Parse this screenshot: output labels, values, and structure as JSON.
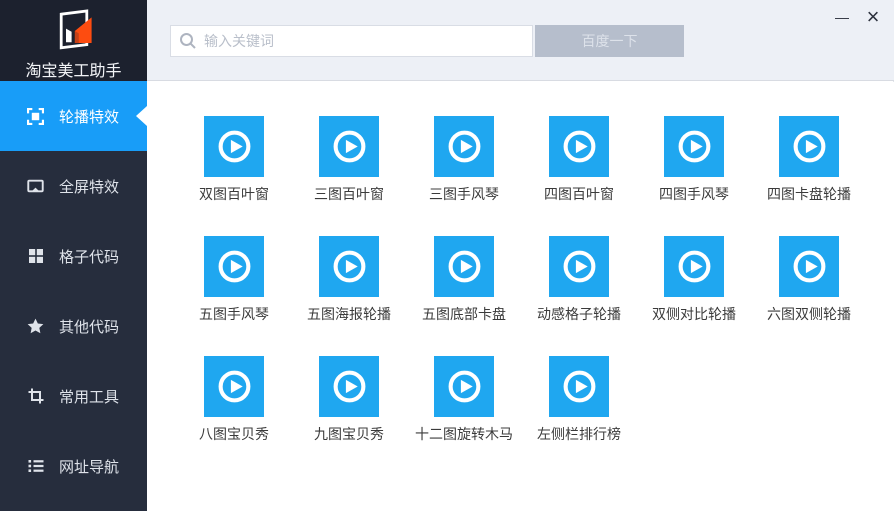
{
  "app": {
    "title": "淘宝美工助手"
  },
  "window_controls": {
    "minimize": "—",
    "close": "×"
  },
  "sidebar": {
    "items": [
      {
        "label": "轮播特效",
        "icon": "carousel-icon",
        "active": true
      },
      {
        "label": "全屏特效",
        "icon": "fullscreen-icon",
        "active": false
      },
      {
        "label": "格子代码",
        "icon": "grid-icon",
        "active": false
      },
      {
        "label": "其他代码",
        "icon": "star-icon",
        "active": false
      },
      {
        "label": "常用工具",
        "icon": "crop-icon",
        "active": false
      },
      {
        "label": "网址导航",
        "icon": "nav-list-icon",
        "active": false
      }
    ]
  },
  "search": {
    "placeholder": "输入关键词",
    "button_label": "百度一下"
  },
  "effects": {
    "tile_icon": "play-icon",
    "items": [
      {
        "label": "双图百叶窗"
      },
      {
        "label": "三图百叶窗"
      },
      {
        "label": "三图手风琴"
      },
      {
        "label": "四图百叶窗"
      },
      {
        "label": "四图手风琴"
      },
      {
        "label": "四图卡盘轮播"
      },
      {
        "label": "五图手风琴"
      },
      {
        "label": "五图海报轮播"
      },
      {
        "label": "五图底部卡盘"
      },
      {
        "label": "动感格子轮播"
      },
      {
        "label": "双侧对比轮播"
      },
      {
        "label": "六图双侧轮播"
      },
      {
        "label": "八图宝贝秀"
      },
      {
        "label": "九图宝贝秀"
      },
      {
        "label": "十二图旋转木马"
      },
      {
        "label": "左侧栏排行榜"
      }
    ]
  },
  "colors": {
    "accent_blue": "#189df8",
    "tile_blue": "#1fa7f0",
    "sidebar_bg": "#262d3d",
    "header_bg": "#1c212e",
    "logo_orange": "#fd4c10"
  }
}
